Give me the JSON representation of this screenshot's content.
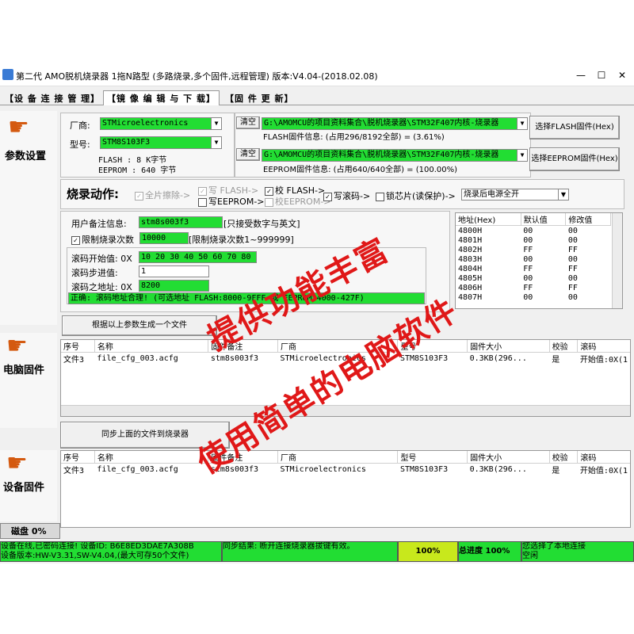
{
  "window": {
    "title": "第二代 AMO脱机烧录器 1拖N路型 (多路烧录,多个固件,远程管理) 版本:V4.04-(2018.02.08)",
    "min": "—",
    "max": "☐",
    "close": "✕"
  },
  "tabs": [
    "【设 备 连 接 管 理】",
    "【镜 像 编 辑 与 下 载】",
    "【固 件 更 新】"
  ],
  "sidebar": {
    "params_label": "参数设置",
    "pc_firmware_label": "电脑固件",
    "device_firmware_label": "设备固件",
    "disk_label": "磁盘 0%"
  },
  "params": {
    "vendor_label": "厂商:",
    "vendor_value": "STMicroelectronics",
    "model_label": "型号:",
    "model_value": "STM8S103F3",
    "flash_info": "FLASH   :  8 K字节",
    "eeprom_info": "EEPROM  :  640 字节",
    "clear1": "清空",
    "flash_path": "G:\\AMOMCU的项目资料集合\\脱机烧录器\\STM32F407内核-烧录器",
    "flash_fw_info": "FLASH固件信息: (占用296/8192全部) = (3.61%)",
    "select_flash_btn": "选择FLASH固件(Hex)",
    "clear2": "清空",
    "eeprom_path": "G:\\AMOMCU的项目资料集合\\脱机烧录器\\STM32F407内核-烧录器",
    "eeprom_fw_info": "EEPROM固件信息: (占用640/640全部) = (100.00%)",
    "select_eeprom_btn": "选择EEPROM固件(Hex)"
  },
  "burn": {
    "title": "烧录动作:",
    "full_erase": "全片擦除->",
    "write_flash": "写 FLASH->",
    "verify_flash": "校 FLASH->",
    "write_eeprom": "写EEPROM->",
    "verify_eeprom": "校EEPROM->",
    "write_roll": "写滚码->",
    "lock_chip": "锁芯片(读保护)->",
    "after_burn": "烧录后电源全开"
  },
  "config": {
    "note_label": "用户备注信息:",
    "note_value": "stm8s003f3",
    "note_hint": "[只接受数字与英文]",
    "limit_label": "限制烧录次数",
    "limit_value": "10000",
    "limit_hint": "[限制烧录次数1~999999]",
    "roll_start_label": "滚码开始值: 0X",
    "roll_start_value": "10 20 30 40 50 60 70 80",
    "roll_step_label": "滚码步进值:",
    "roll_step_value": "1",
    "roll_addr_label": "滚码之地址: 0X",
    "roll_addr_value": "8200",
    "roll_status": "正确: 滚码地址合理! (可选地址 FLASH:8000-9FFF 或 EEPROM:4000-427F)",
    "generate_btn": "根据以上参数生成一个文件"
  },
  "addr_table": {
    "headers": [
      "地址(Hex)",
      "默认值",
      "修改值"
    ],
    "rows": [
      [
        "4800H",
        "00",
        "00"
      ],
      [
        "4801H",
        "00",
        "00"
      ],
      [
        "4802H",
        "FF",
        "FF"
      ],
      [
        "4803H",
        "00",
        "00"
      ],
      [
        "4804H",
        "FF",
        "FF"
      ],
      [
        "4805H",
        "00",
        "00"
      ],
      [
        "4806H",
        "FF",
        "FF"
      ],
      [
        "4807H",
        "00",
        "00"
      ]
    ]
  },
  "file_table": {
    "headers": [
      "序号",
      "名称",
      "固件备注",
      "厂商",
      "型号",
      "固件大小",
      "校验",
      "滚码"
    ],
    "rows": [
      [
        "文件3",
        "file_cfg_003.acfg",
        "stm8s003f3",
        "STMicroelectronics",
        "STM8S103F3",
        "0.3KB(296...",
        "是",
        "开始值:0X(1"
      ]
    ]
  },
  "sync_btn": "同步上面的文件到烧录器",
  "status": {
    "device": "设备在线,已密码连接! 设备ID: B6E8ED3DAE7A308B",
    "version": "设备版本:HW-V3.31,SW-V4.04,(最大可存50个文件)",
    "sync_result": "同步结果: 断开连接烧录器拔键有效。",
    "progress": "100%",
    "total_label": "总进度",
    "total_progress": "100%",
    "local_connect": "您选择了本地连接",
    "idle": "空闲"
  },
  "watermark": {
    "line1": "提供功能丰富",
    "line2": "使用简单的电脑软件"
  },
  "colors": {
    "green": "#22dd33",
    "watermark": "#e01818",
    "accent_hand": "#d45a10"
  }
}
